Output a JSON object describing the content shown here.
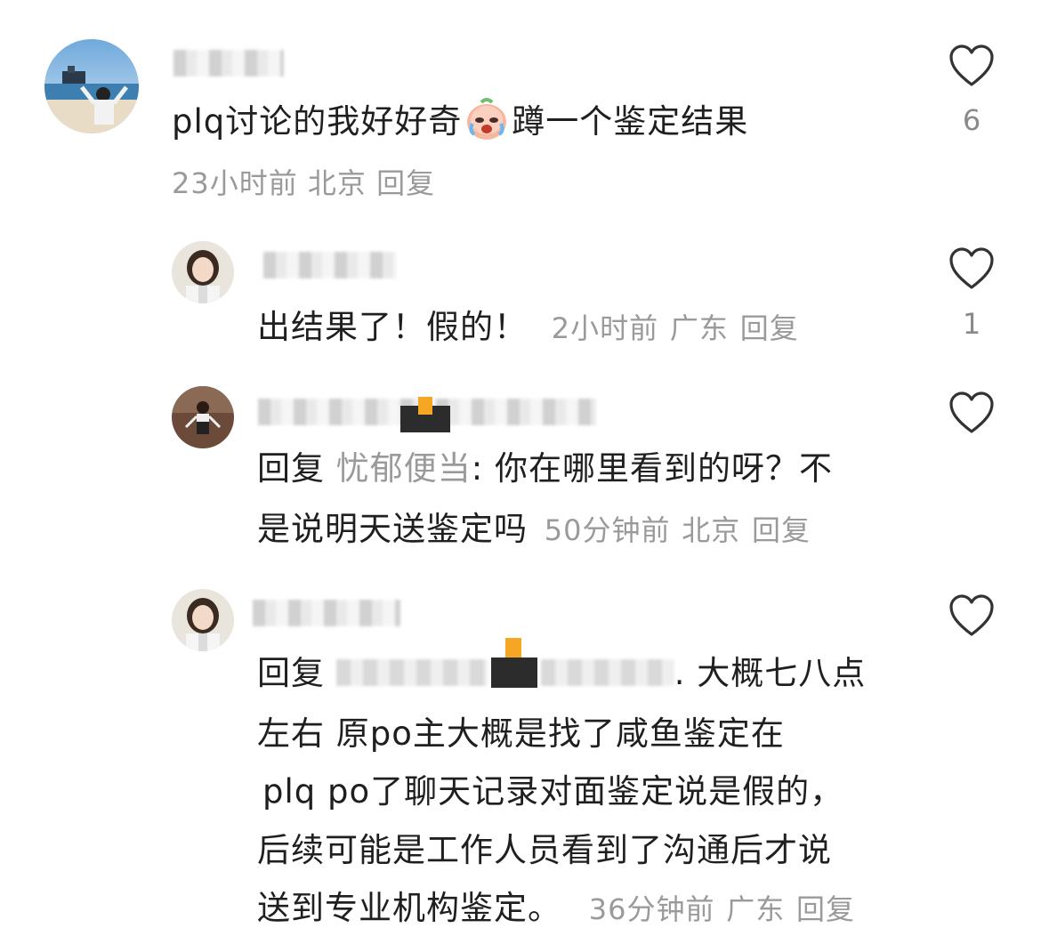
{
  "comments": [
    {
      "text": "plq讨论的我好好奇",
      "text_after_emoji": "蹲一个鉴定结果",
      "emoji_icon": "crying-face-emoji",
      "time": "23小时前",
      "location": "北京",
      "reply_label": "回复",
      "like_count": "6"
    }
  ],
  "replies": [
    {
      "text": "出结果了！假的！",
      "time": "2小时前",
      "location": "广东",
      "reply_label": "回复",
      "like_count": "1"
    },
    {
      "prefix": "回复",
      "mention": "忧郁便当",
      "line1": ": 你在哪里看到的呀？不",
      "line2": "是说明天送鉴定吗",
      "time": "50分钟前",
      "location": "北京",
      "reply_label": "回复"
    },
    {
      "prefix": "回复",
      "line1_tail": ". 大概七八点",
      "line2": "左右 原po主大概是找了咸鱼鉴定在",
      "line3": "plq po了聊天记录对面鉴定说是假的，",
      "line4": "后续可能是工作人员看到了沟通后才说",
      "line5": "送到专业机构鉴定。",
      "time": "36分钟前",
      "location": "广东",
      "reply_label": "回复"
    }
  ],
  "colors": {
    "text": "#1f1f1f",
    "meta": "#9a9a9a",
    "heart_stroke": "#333333"
  }
}
